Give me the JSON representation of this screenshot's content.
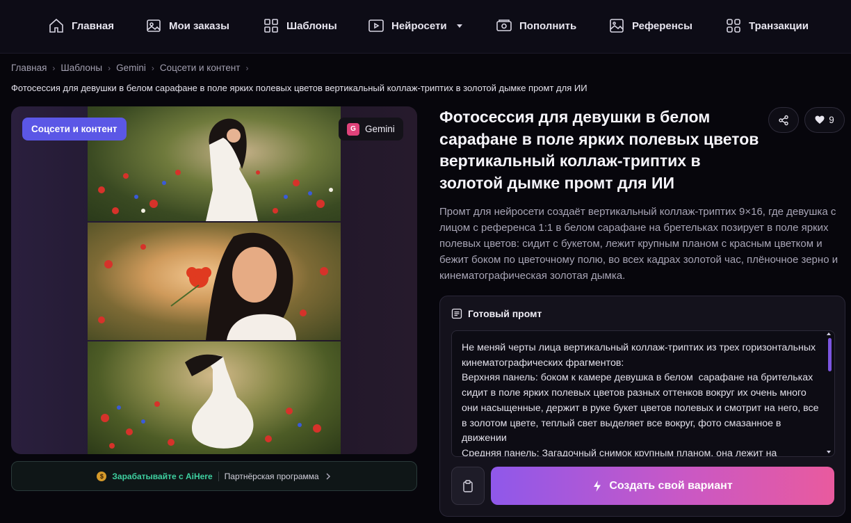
{
  "nav": {
    "items": [
      {
        "label": "Главная",
        "icon": "home-icon"
      },
      {
        "label": "Мои заказы",
        "icon": "image-icon"
      },
      {
        "label": "Шаблоны",
        "icon": "grid-icon"
      },
      {
        "label": "Нейросети",
        "icon": "play-icon",
        "dropdown": true
      },
      {
        "label": "Пополнить",
        "icon": "wallet-icon"
      },
      {
        "label": "Референсы",
        "icon": "picture-icon"
      },
      {
        "label": "Транзакции",
        "icon": "grid-icon"
      }
    ]
  },
  "breadcrumb": [
    "Главная",
    "Шаблоны",
    "Gemini",
    "Соцсети и контент"
  ],
  "page_subtitle": "Фотосессия для девушки в белом сарафане в поле ярких полевых цветов вертикальный коллаж-триптих в золотой дымке промт для ИИ",
  "card": {
    "category_badge": "Соцсети и контент",
    "model_badge": "Gemini",
    "model_badge_letter": "G"
  },
  "affiliate": {
    "earn_label": "Зарабатывайте с AiHere",
    "program_label": "Партнёрская программа"
  },
  "detail": {
    "title": "Фотосессия для девушки в белом сарафане в поле ярких полевых цветов вертикальный коллаж-триптих в золотой дымке промт для ИИ",
    "likes": "9",
    "description": "Промт для нейросети создаёт вертикальный коллаж-триптих 9×16, где девушка с лицом с референса 1:1 в белом сарафане на бретельках позирует в поле ярких полевых цветов: сидит с букетом, лежит крупным планом с красным цветком и бежит боком по цветочному полю, во всех кадрах золотой час, плёночное зерно и кинематографическая золотая дымка."
  },
  "prompt": {
    "heading": "Готовый промт",
    "text": "Не меняй черты лица вертикальный коллаж-триптих из трех горизонтальных кинематографических фрагментов:\nВерхняя панель: боком к камере девушка в белом  сарафане на брительках сидит в поле ярких полевых цветов разных оттенков вокруг их очень много они насыщенные, держит в руке букет цветов полевых и смотрит на него, все в золотом цвете, теплый свет выделяет все вокруг, фото смазанное в движении\nСредняя панель: Загадочный снимок крупным планом, она лежит на",
    "create_label": "Создать свой вариант"
  },
  "colors": {
    "accent": "#5b57e6",
    "gradient_start": "#8f58ea",
    "gradient_end": "#e95a9e",
    "earn": "#3ed0a0"
  }
}
